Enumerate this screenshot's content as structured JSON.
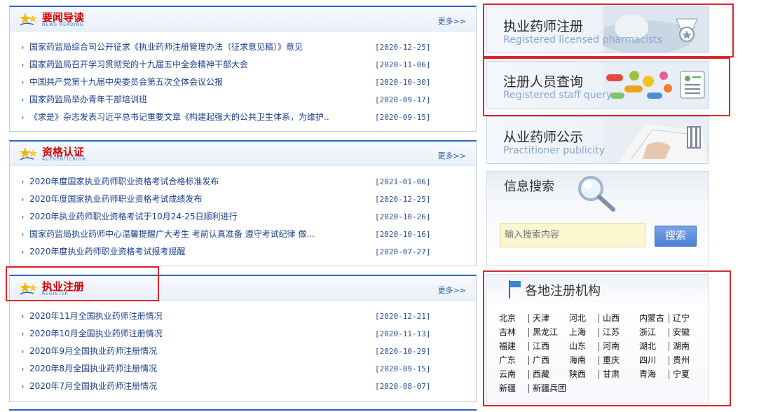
{
  "panels": [
    {
      "title": "要闻导读",
      "subtitle": "NEWS READING",
      "more": "更多>>",
      "items": [
        {
          "text": "国家药监局综合司公开征求《执业药师注册管理办法（征求意见稿）》意见",
          "date": "[2020-12-25]"
        },
        {
          "text": "国家药监局召开学习贯彻党的十九届五中全会精神干部大会",
          "date": "[2020-11-06]"
        },
        {
          "text": "中国共产党第十九届中央委员会第五次全体会议公报",
          "date": "[2020-10-30]"
        },
        {
          "text": "国家药监局举办青年干部培训班",
          "date": "[2020-09-17]"
        },
        {
          "text": "《求是》杂志发表习近平总书记重要文章《构建起强大的公共卫生体系，为维护..",
          "date": "[2020-09-15]"
        }
      ]
    },
    {
      "title": "资格认证",
      "subtitle": "AUTHENTICRION",
      "more": "更多>>",
      "items": [
        {
          "text": "2020年度国家执业药师职业资格考试合格标准发布",
          "date": "[2021-01-06]"
        },
        {
          "text": "2020年度国家执业药师职业资格考试成绩发布",
          "date": "[2020-12-25]"
        },
        {
          "text": "2020年执业药师职业资格考试于10月24-25日顺利进行",
          "date": "[2020-10-26]"
        },
        {
          "text": "国家药监局执业药师中心温馨提醒广大考生 考前认真准备 遵守考试纪律 做...",
          "date": "[2020-10-16]"
        },
        {
          "text": "2020年度执业药师职业资格考试报考提醒",
          "date": "[2020-07-27]"
        }
      ]
    },
    {
      "title": "执业注册",
      "subtitle": "REGISTER",
      "more": "更多>>",
      "items": [
        {
          "text": "2020年11月全国执业药师注册情况",
          "date": "[2020-12-21]"
        },
        {
          "text": "2020年10月全国执业药师注册情况",
          "date": "[2020-11-13]"
        },
        {
          "text": "2020年9月全国执业药师注册情况",
          "date": "[2020-10-29]"
        },
        {
          "text": "2020年8月全国执业药师注册情况",
          "date": "[2020-09-15]"
        },
        {
          "text": "2020年7月全国执业药师注册情况",
          "date": "[2020-08-07]"
        }
      ]
    }
  ],
  "banners": [
    {
      "cn": "执业药师注册",
      "en": "Registered licensed pharmacists"
    },
    {
      "cn": "注册人员查询",
      "en": "Registered staff query"
    },
    {
      "cn": "从业药师公示",
      "en": "Practitioner publicity"
    }
  ],
  "search": {
    "title": "信息搜索",
    "placeholder": "输入搜索内容",
    "button": "搜索"
  },
  "regions": {
    "title": "各地注册机构",
    "items": [
      "北京",
      "天津",
      "河北",
      "山西",
      "内蒙古",
      "辽宁",
      "吉林",
      "黑龙江",
      "上海",
      "江苏",
      "浙江",
      "安徽",
      "福建",
      "江西",
      "山东",
      "河南",
      "湖北",
      "湖南",
      "广东",
      "广西",
      "海南",
      "重庆",
      "四川",
      "贵州",
      "云南",
      "西藏",
      "陕西",
      "甘肃",
      "青海",
      "宁夏",
      "新疆",
      "新疆兵团"
    ]
  },
  "colors": {
    "accent_blue": "#2c63c2",
    "title_red": "#d40000",
    "link_blue": "#1a3f8c",
    "highlight_red": "#d9262c",
    "search_input_bg": "#fbf7d0"
  }
}
